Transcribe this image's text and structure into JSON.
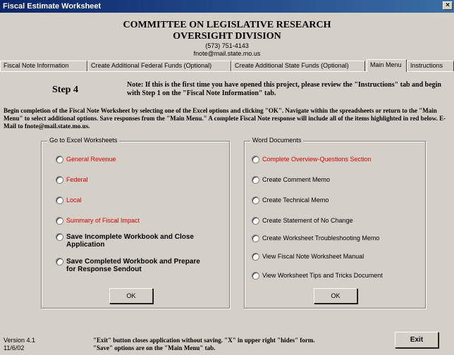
{
  "window": {
    "title": "Fiscal Estimate Worksheet",
    "close_label": "×"
  },
  "header": {
    "org": "COMMITTEE ON LEGISLATIVE RESEARCH",
    "division": "OVERSIGHT DIVISION",
    "phone": "(573) 751-4143",
    "email": "fnote@mail.state.mo.us"
  },
  "tabs": [
    {
      "label": "Fiscal Note Information"
    },
    {
      "label": "Create Additional Federal Funds (Optional)"
    },
    {
      "label": "Create Additional State Funds (Optional)"
    },
    {
      "label": "Main Menu"
    },
    {
      "label": "Instructions"
    }
  ],
  "main": {
    "step": "Step 4",
    "note": "Note: If this is the first time you have opened this project, please review the \"Instructions\" tab and begin with Step 1 on the \"Fiscal Note Information\" tab.",
    "intro": "Begin completion of the Fiscal Note Worksheet by selecting one of the Excel options and clicking \"OK\". Navigate within the spreadsheets or return to the \"Main Menu\" to select additional options. Save responses from the \"Main Menu.\" A complete Fiscal Note response will include all of the items highlighted in red below. E-Mail to fnote@mail.state.mo.us."
  },
  "excel": {
    "legend": "Go to Excel Worksheets",
    "options": [
      {
        "label": "General Revenue"
      },
      {
        "label": "Federal"
      },
      {
        "label": "Local"
      },
      {
        "label": "Summary of Fiscal Impact"
      },
      {
        "label": "Save Incomplete Workbook and Close Application"
      },
      {
        "label": "Save Completed Workbook and Prepare for Response Sendout"
      }
    ],
    "ok_label": "OK"
  },
  "word": {
    "legend": "Word Documents",
    "options": [
      {
        "label": "Complete Overview-Questions Section"
      },
      {
        "label": "Create Comment Memo"
      },
      {
        "label": "Create Technical Memo"
      },
      {
        "label": "Create Statement of No Change"
      },
      {
        "label": "Create Worksheet Troubleshooting Memo"
      },
      {
        "label": "View Fiscal Note Worksheet Manual"
      },
      {
        "label": "View Worksheet Tips and Tricks Document"
      }
    ],
    "ok_label": "OK"
  },
  "footer": {
    "version": "Version 4.1",
    "date": "11/6/02",
    "hint": "\"Exit\" button closes application without saving. \"X\" in upper right \"hides\" form. \"Save\" options are on the \"Main Menu\" tab.",
    "exit_label": "Exit"
  }
}
